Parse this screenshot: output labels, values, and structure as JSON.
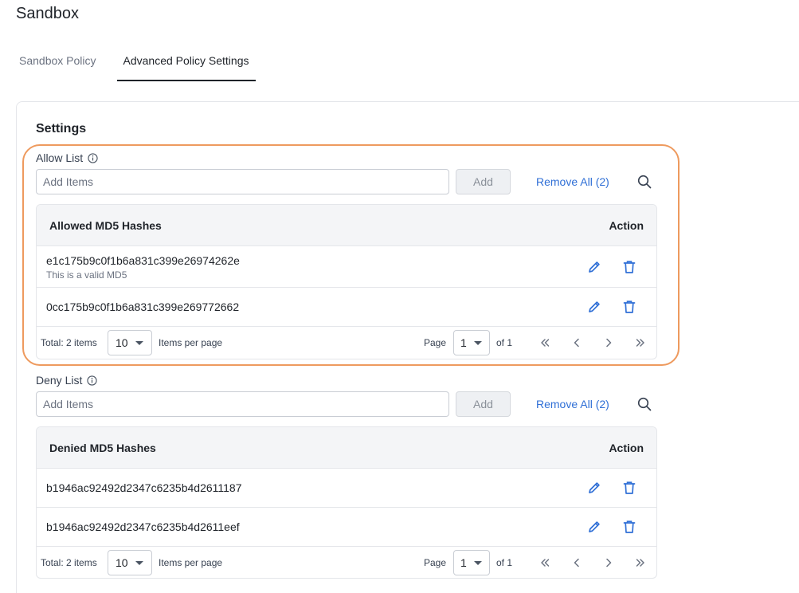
{
  "page": {
    "title": "Sandbox"
  },
  "tabs": [
    {
      "label": "Sandbox Policy",
      "active": false
    },
    {
      "label": "Advanced Policy Settings",
      "active": true
    }
  ],
  "settings": {
    "title": "Settings"
  },
  "colors": {
    "accent": "#2f6fd6",
    "highlight": "#ee9a5e",
    "text": "#1f2329"
  },
  "allow_list": {
    "label": "Allow List",
    "input_placeholder": "Add Items",
    "add_label": "Add",
    "remove_all_label": "Remove All (2)",
    "table": {
      "column_hash": "Allowed MD5 Hashes",
      "column_action": "Action",
      "rows": [
        {
          "hash": "e1c175b9c0f1b6a831c399e26974262e",
          "note": "This is a valid MD5"
        },
        {
          "hash": "0cc175b9c0f1b6a831c399e269772662",
          "note": ""
        }
      ]
    },
    "pagination": {
      "total_label": "Total: 2 items",
      "per_page_value": "10",
      "per_page_label": "Items per page",
      "page_label": "Page",
      "page_value": "1",
      "of_label": "of 1"
    }
  },
  "deny_list": {
    "label": "Deny List",
    "input_placeholder": "Add Items",
    "add_label": "Add",
    "remove_all_label": "Remove All (2)",
    "table": {
      "column_hash": "Denied MD5 Hashes",
      "column_action": "Action",
      "rows": [
        {
          "hash": "b1946ac92492d2347c6235b4d2611187",
          "note": ""
        },
        {
          "hash": "b1946ac92492d2347c6235b4d2611eef",
          "note": ""
        }
      ]
    },
    "pagination": {
      "total_label": "Total: 2 items",
      "per_page_value": "10",
      "per_page_label": "Items per page",
      "page_label": "Page",
      "page_value": "1",
      "of_label": "of 1"
    }
  }
}
